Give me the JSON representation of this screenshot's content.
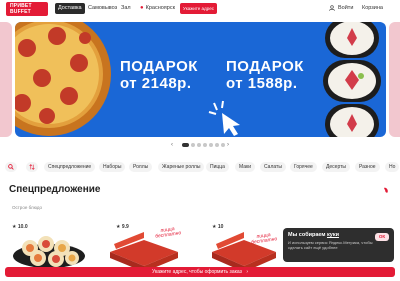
{
  "header": {
    "logo_line1": "ПРИВЕТ",
    "logo_line2": "BUFFET",
    "tabs": [
      "Доставка",
      "Самовывоз",
      "Зал"
    ],
    "city": "Красноярск",
    "address_button": "Укажите адрес",
    "login": "Войти",
    "cart": "Корзина"
  },
  "banner": {
    "offer1_line1": "ПОДАРОК",
    "offer1_line2": "от 2148р.",
    "offer2_line1": "ПОДАРОК",
    "offer2_line2": "от 1588р.",
    "prev_arrow": "‹",
    "next_arrow": "›",
    "slide_count": 8,
    "active_slide": 1
  },
  "categories": [
    "Спецпредложение",
    "Наборы",
    "Роллы",
    "Жареные роллы",
    "Пицца",
    "Маки",
    "Салаты",
    "Горячее",
    "Десерты",
    "Разное",
    "Но"
  ],
  "section": {
    "title": "Спецпредложение",
    "subfilter": "Острое блюдо"
  },
  "cards": [
    {
      "rating": "★ 10.0"
    },
    {
      "rating": "★ 9.9",
      "tagline": "пицца бесплатно"
    },
    {
      "rating": "★ 10",
      "tagline": "пицца бесплатно"
    }
  ],
  "cookie": {
    "title_prefix": "Мы собираем ",
    "title_link": "куки",
    "text": "И используем сервис Яндекс.Метрика, чтобы сделать сайт ещё удобнее",
    "ok_label": "ОК"
  },
  "bottom_bar": {
    "text": "Укажите адрес, чтобы оформить заказ",
    "arrow": "›"
  },
  "colors": {
    "brand_red": "#e31b36",
    "banner_blue": "#1a67d6",
    "dark": "#2b2b2b"
  }
}
